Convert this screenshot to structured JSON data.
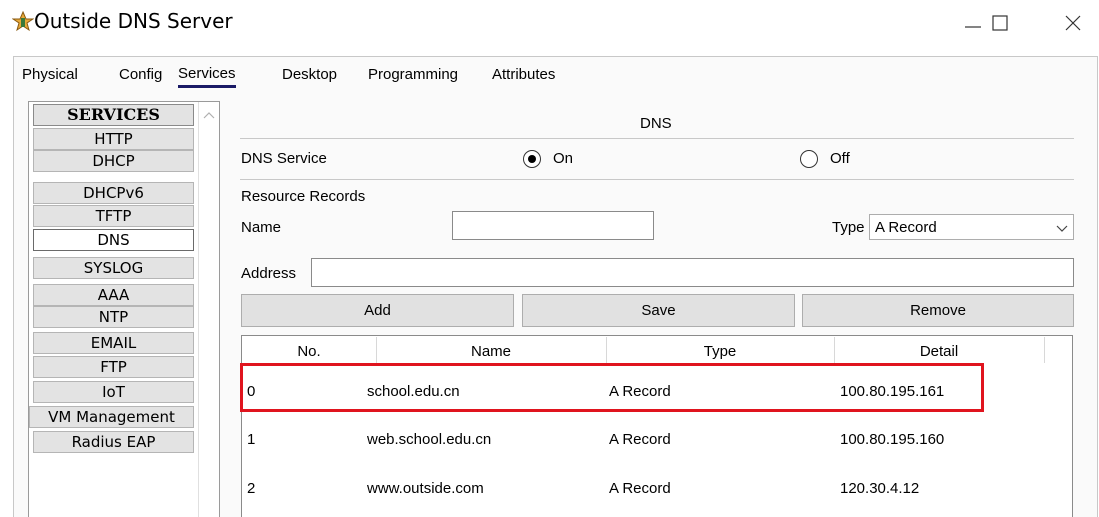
{
  "window": {
    "title": "Outside DNS Server",
    "icon": "packet-tracer-server-icon"
  },
  "tabs": [
    {
      "label": "Physical",
      "active": false
    },
    {
      "label": "Config",
      "active": false
    },
    {
      "label": "Services",
      "active": true
    },
    {
      "label": "Desktop",
      "active": false
    },
    {
      "label": "Programming",
      "active": false
    },
    {
      "label": "Attributes",
      "active": false
    }
  ],
  "services": {
    "header": "SERVICES",
    "items": [
      "HTTP",
      "DHCP",
      "DHCPv6",
      "TFTP",
      "DNS",
      "SYSLOG",
      "AAA",
      "NTP",
      "EMAIL",
      "FTP",
      "IoT",
      "VM Management",
      "Radius EAP"
    ],
    "selected": "DNS"
  },
  "dns": {
    "section_title": "DNS",
    "service_label": "DNS Service",
    "on_label": "On",
    "off_label": "Off",
    "service_state": "On",
    "resource_records_label": "Resource Records",
    "name_label": "Name",
    "name_value": "",
    "type_label": "Type",
    "type_value": "A Record",
    "address_label": "Address",
    "address_value": "",
    "add_label": "Add",
    "save_label": "Save",
    "remove_label": "Remove"
  },
  "records": {
    "columns": [
      "No.",
      "Name",
      "Type",
      "Detail"
    ],
    "rows": [
      {
        "no": "0",
        "name": "school.edu.cn",
        "type": "A Record",
        "detail": "100.80.195.161",
        "highlighted": true
      },
      {
        "no": "1",
        "name": "web.school.edu.cn",
        "type": "A Record",
        "detail": "100.80.195.160",
        "highlighted": false
      },
      {
        "no": "2",
        "name": "www.outside.com",
        "type": "A Record",
        "detail": "120.30.4.12",
        "highlighted": false
      }
    ]
  },
  "colors": {
    "highlight_border": "#e0141e",
    "active_tab_underline": "#1a1a66"
  }
}
